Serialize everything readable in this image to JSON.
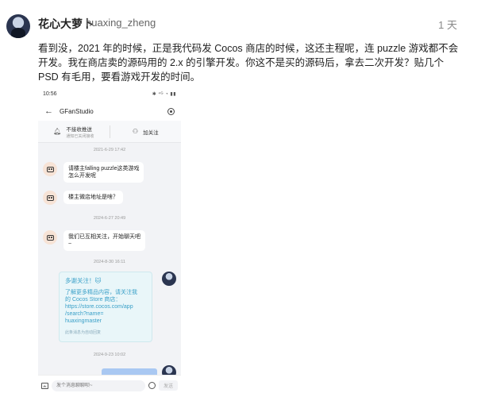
{
  "post": {
    "username": "花心大萝卜",
    "handle": "huaxing_zheng",
    "timestamp": "1 天",
    "text": "看到没，2021 年的时候，正是我代码发 Cocos 商店的时候，这还主程呢，连 puzzle 游戏都不会开发。我在商店卖的源码用的 2.x 的引擎开发。你这不是买的源码后，拿去二次开发？贴几个 PSD 有毛用，要看游戏开发的时间。"
  },
  "screenshot": {
    "status_time": "10:56",
    "status_icons": "✱ ⁴ᴳ ◔ ▮▮",
    "chat_title": "GFanStudio",
    "action_left": "不接收推送",
    "action_left_sub": "通知已关闭接收",
    "action_right": "加关注",
    "dates": [
      "2021-6-29 17:42",
      "2024-6-27 20:49",
      "2024-8-30 16:11",
      "2024-9-23 10:02"
    ],
    "messages": [
      "请楼主falling puzzle这类游戏\n怎么开发呢",
      "楼主微店地址是啥？",
      "我们已互相关注，开始聊天吧\n~"
    ],
    "card": {
      "title": "多谢关注！🐱",
      "body": "了解更多精品内容，请关注我\n的 Cocos Store 商店：\nhttps://store.cocos.com/app\n/search?name=\nhuaxingmaster",
      "footer": "此条消息为自动回复"
    },
    "input_placeholder": "发个消息聊聊呗~",
    "send_label": "发送"
  }
}
